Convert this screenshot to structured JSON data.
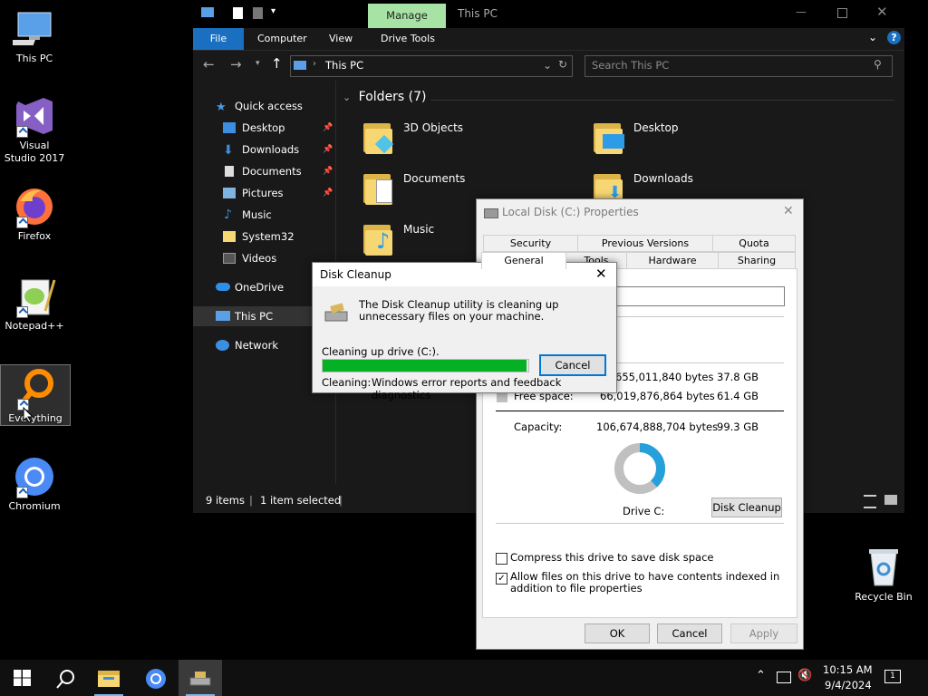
{
  "desktop": {
    "icons": [
      {
        "label": "This PC"
      },
      {
        "label": "Visual Studio 2017"
      },
      {
        "label": "Firefox"
      },
      {
        "label": "Notepad++"
      },
      {
        "label": "Everything"
      },
      {
        "label": "Chromium"
      },
      {
        "label": "Recycle Bin"
      }
    ]
  },
  "explorer": {
    "context_tab": "Manage",
    "title": "This PC",
    "ribbon_tabs": [
      "File",
      "Computer",
      "View",
      "Drive Tools"
    ],
    "address": "This PC",
    "search_placeholder": "Search This PC",
    "nav": [
      {
        "label": "Quick access"
      },
      {
        "label": "Desktop"
      },
      {
        "label": "Downloads"
      },
      {
        "label": "Documents"
      },
      {
        "label": "Pictures"
      },
      {
        "label": "Music"
      },
      {
        "label": "System32"
      },
      {
        "label": "Videos"
      },
      {
        "label": "OneDrive"
      },
      {
        "label": "This PC"
      },
      {
        "label": "Network"
      }
    ],
    "folders_header": "Folders (7)",
    "folders": [
      {
        "name": "3D Objects"
      },
      {
        "name": "Desktop"
      },
      {
        "name": "Documents"
      },
      {
        "name": "Downloads"
      },
      {
        "name": "Music"
      }
    ],
    "status": {
      "items": "9 items",
      "selected": "1 item selected"
    }
  },
  "properties": {
    "title": "Local Disk (C:) Properties",
    "tabs_row1": [
      "Security",
      "Previous Versions",
      "Quota"
    ],
    "tabs_row2": [
      "General",
      "Tools",
      "Hardware",
      "Sharing"
    ],
    "used_bytes": "655,011,840 bytes",
    "used_gb": "37.8 GB",
    "free_label": "Free space:",
    "free_bytes": "66,019,876,864 bytes",
    "free_gb": "61.4 GB",
    "capacity_label": "Capacity:",
    "capacity_bytes": "106,674,888,704 bytes",
    "capacity_gb": "99.3 GB",
    "drive_label": "Drive C:",
    "disk_cleanup_button": "Disk Cleanup",
    "compress_label": "Compress this drive to save disk space",
    "index_label": "Allow files on this drive to have contents indexed in addition to file properties",
    "ok": "OK",
    "cancel": "Cancel",
    "apply": "Apply",
    "used_fraction": 0.381
  },
  "cleanup": {
    "title": "Disk Cleanup",
    "message": "The Disk Cleanup utility is cleaning up unnecessary files on your machine.",
    "cleaning_drive": "Cleaning up drive  (C:).",
    "cancel": "Cancel",
    "cleaning_label": "Cleaning:",
    "cleaning_item": "Windows error reports and feedback diagnostics",
    "progress": 0.99
  },
  "taskbar": {
    "time": "10:15 AM",
    "date": "9/4/2024"
  },
  "colors": {
    "accent": "#1a6fc0",
    "progress": "#06b025"
  }
}
